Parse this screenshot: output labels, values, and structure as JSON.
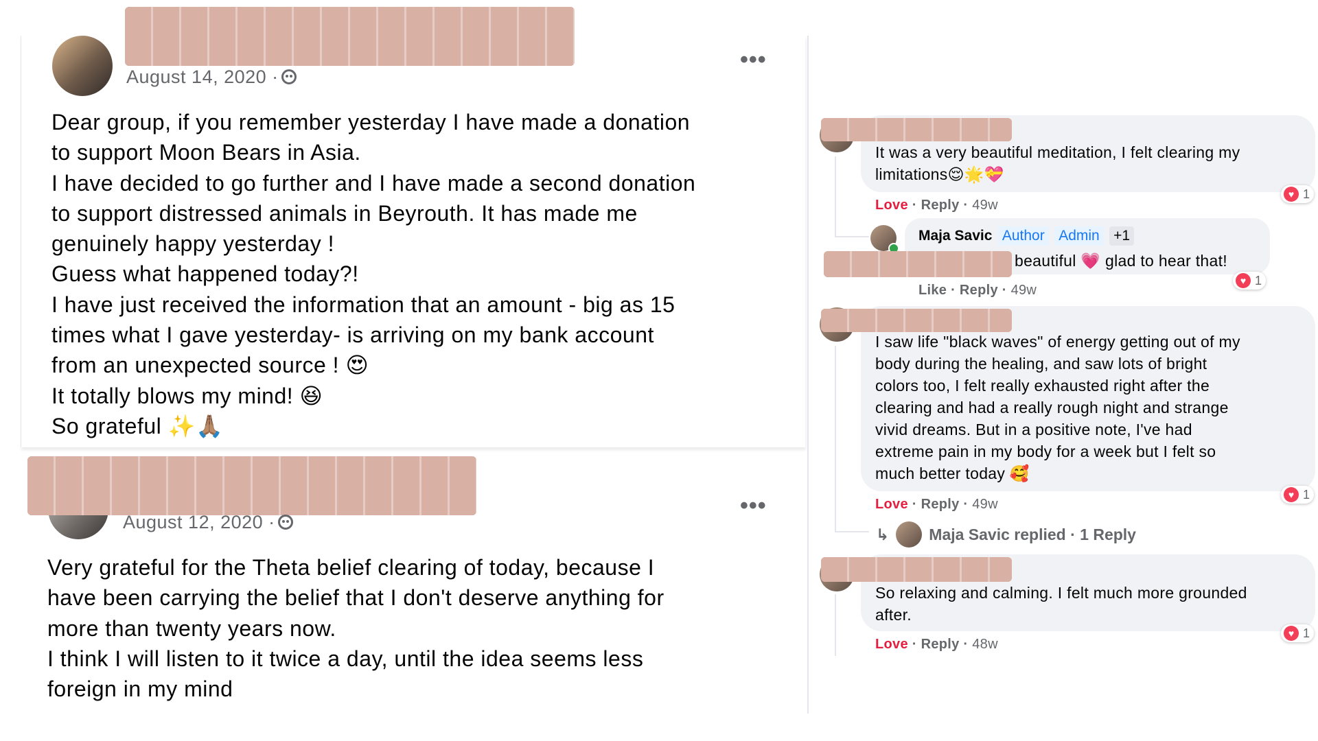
{
  "post1": {
    "date": "August 14, 2020 ·",
    "privacy_icon": "group-icon",
    "more": "•••",
    "body": "Dear group, if you remember yesterday I have made a donation\nto support Moon Bears in Asia.\nI have decided to go further and I have made a second donation\nto support distressed animals in Beyrouth. It has made me\ngenuinely happy yesterday !\nGuess what happened today?!\nI have just received the information that an amount - big as 15\ntimes what I gave yesterday- is arriving on my bank account\nfrom an unexpected source ! 😍\nIt totally blows my mind! 😆\nSo grateful ✨🙏🏽"
  },
  "post2": {
    "date": "August 12, 2020 ·",
    "privacy_icon": "group-icon",
    "more": "•••",
    "body": "Very grateful for the Theta belief clearing of today, because  I\nhave been carrying the belief that I don't deserve anything for\nmore than twenty years now.\nI think I will listen to it twice a day, until the idea seems less\nforeign in my mind"
  },
  "comments": [
    {
      "text": "It was a very beautiful meditation, I felt clearing my\nlimitations😌🌟💝",
      "love": "Love",
      "reply": "Reply",
      "time": "49w",
      "reactions": "1"
    },
    {
      "reply_author": "Maja Savic",
      "badges": [
        "Author",
        "Admin",
        "+1"
      ],
      "reply_text": "beautiful 💗 glad to hear that!",
      "like": "Like",
      "reply": "Reply",
      "time": "49w",
      "reactions": "1"
    },
    {
      "text": "I saw life \"black waves\" of energy getting out of my\nbody during the healing, and saw lots of bright\ncolors too, I felt really exhausted right after the\nclearing and had a really rough night and strange\nvivid dreams. But in a positive note, I've had\nextreme pain in my body for a week but I felt so\nmuch better today 🥰",
      "love": "Love",
      "reply": "Reply",
      "time": "49w",
      "reactions": "1",
      "replied_summary": "Maja Savic replied · 1 Reply"
    },
    {
      "text": "So relaxing and calming. I felt much more grounded\nafter.",
      "love": "Love",
      "reply": "Reply",
      "time": "48w",
      "reactions": "1"
    }
  ],
  "colors": {
    "love": "#e41e3f",
    "badge_blue": "#1877f2",
    "bubble": "#f0f2f5",
    "redaction": "#d8b0a4"
  }
}
